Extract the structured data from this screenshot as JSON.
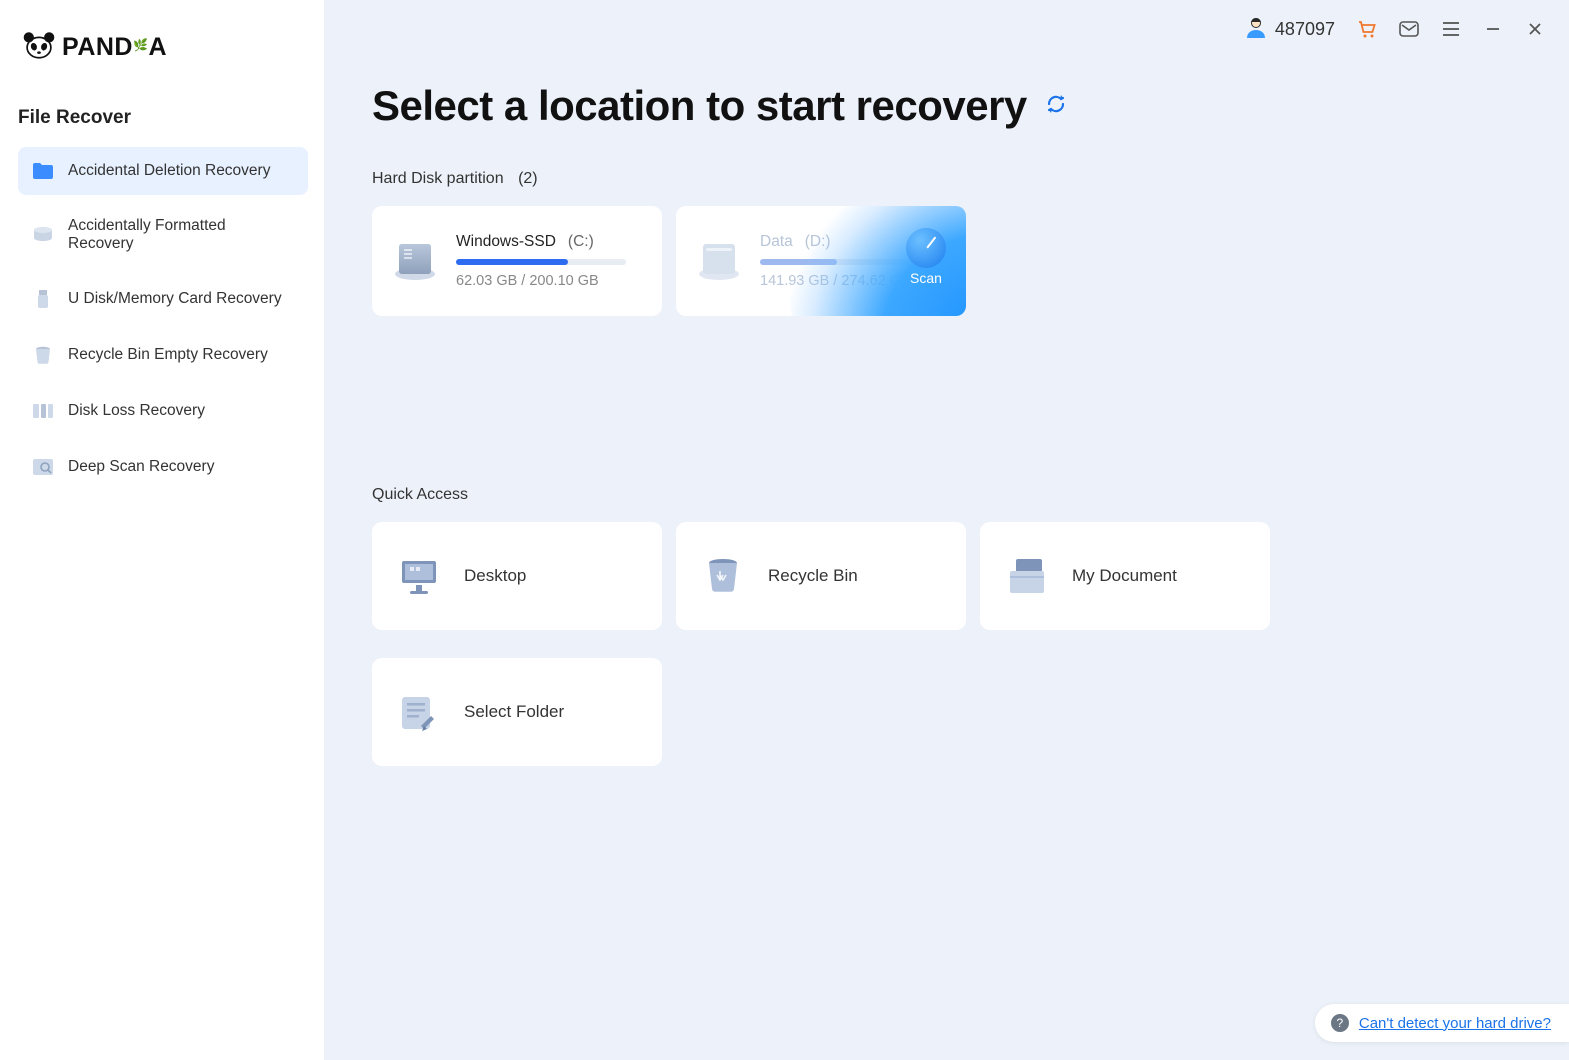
{
  "brand": {
    "name": "PANDA"
  },
  "sidebar": {
    "title": "File Recover",
    "items": [
      {
        "label": "Accidental Deletion Recovery",
        "active": true
      },
      {
        "label": "Accidentally Formatted Recovery",
        "active": false
      },
      {
        "label": "U Disk/Memory Card Recovery",
        "active": false
      },
      {
        "label": "Recycle Bin Empty Recovery",
        "active": false
      },
      {
        "label": "Disk Loss Recovery",
        "active": false
      },
      {
        "label": "Deep Scan Recovery",
        "active": false
      }
    ]
  },
  "topbar": {
    "user_id": "487097"
  },
  "main": {
    "title": "Select a location to start recovery",
    "partitions_label": "Hard Disk partition",
    "partitions_count": "(2)",
    "partitions": [
      {
        "name": "Windows-SSD",
        "letter": "(C:)",
        "used": "62.03 GB",
        "total": "200.10 GB",
        "percent": 66,
        "hovered": false
      },
      {
        "name": "Data",
        "letter": "(D:)",
        "used": "141.93 GB",
        "total": "274.62 GB",
        "percent": 45,
        "hovered": true,
        "scan_label": "Scan"
      }
    ],
    "quick_label": "Quick Access",
    "quick": [
      {
        "label": "Desktop"
      },
      {
        "label": "Recycle Bin"
      },
      {
        "label": "My Document"
      },
      {
        "label": "Select Folder"
      }
    ],
    "help_text": "Can't detect your hard drive?"
  }
}
